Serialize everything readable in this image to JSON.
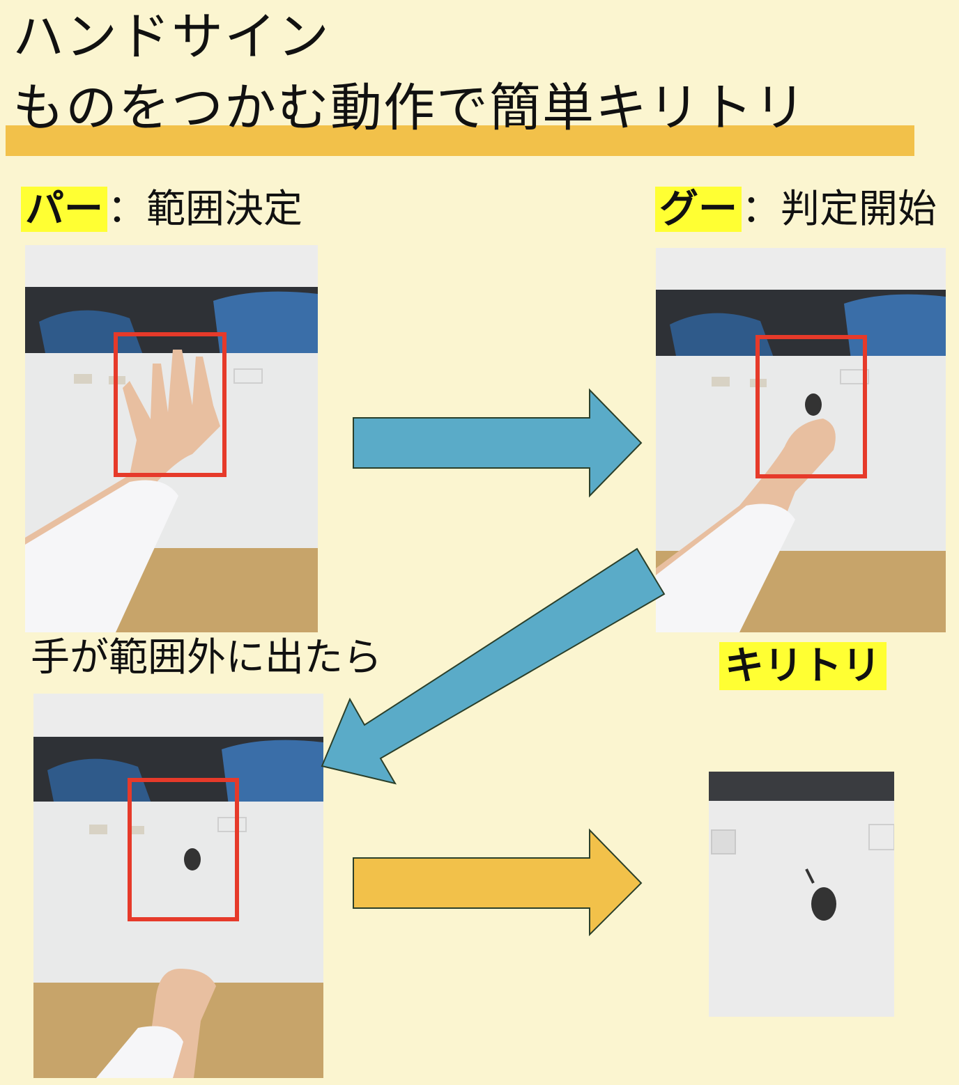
{
  "title": {
    "line1": "ハンドサイン",
    "line2": "ものをつかむ動作で簡単キリトリ"
  },
  "steps": {
    "paa": {
      "sign": "パー",
      "desc": "：範囲決定"
    },
    "guu": {
      "sign": "グー",
      "desc": "：判定開始"
    },
    "hand_out": {
      "text": "手が範囲外に出たら"
    },
    "crop": {
      "text": "キリトリ"
    }
  },
  "colors": {
    "background": "#fbf5d0",
    "title_underline": "#f2c14a",
    "highlight": "#ffff33",
    "arrow_blue": "#5aabc8",
    "arrow_yellow": "#f2c14a",
    "selection_box": "#e63a2a"
  }
}
